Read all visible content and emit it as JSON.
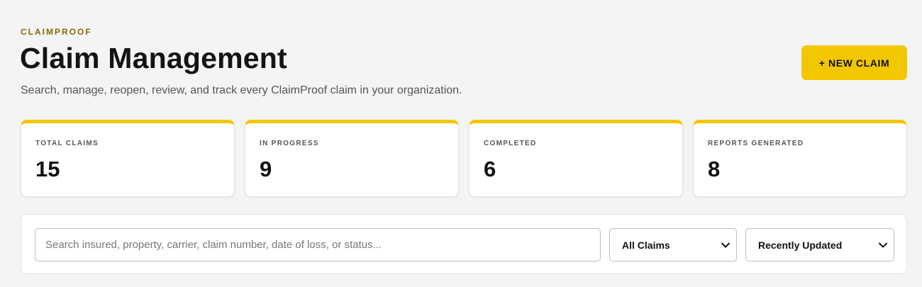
{
  "brand": {
    "eyebrow": "CLAIMPROOF"
  },
  "header": {
    "title": "Claim Management",
    "subtitle": "Search, manage, reopen, review, and track every ClaimProof claim in your organization.",
    "new_claim_label": "+ NEW CLAIM"
  },
  "stats": [
    {
      "label": "TOTAL CLAIMS",
      "value": "15"
    },
    {
      "label": "IN PROGRESS",
      "value": "9"
    },
    {
      "label": "COMPLETED",
      "value": "6"
    },
    {
      "label": "REPORTS GENERATED",
      "value": "8"
    }
  ],
  "filters": {
    "search_placeholder": "Search insured, property, carrier, claim number, date of loss, or status...",
    "search_value": "",
    "status_selected": "All Claims",
    "sort_selected": "Recently Updated"
  },
  "colors": {
    "accent": "#f2c600",
    "eyebrow": "#8a6a00",
    "background": "#f4f4f4"
  },
  "icons": {
    "select_arrow": "chevron-down-icon"
  }
}
